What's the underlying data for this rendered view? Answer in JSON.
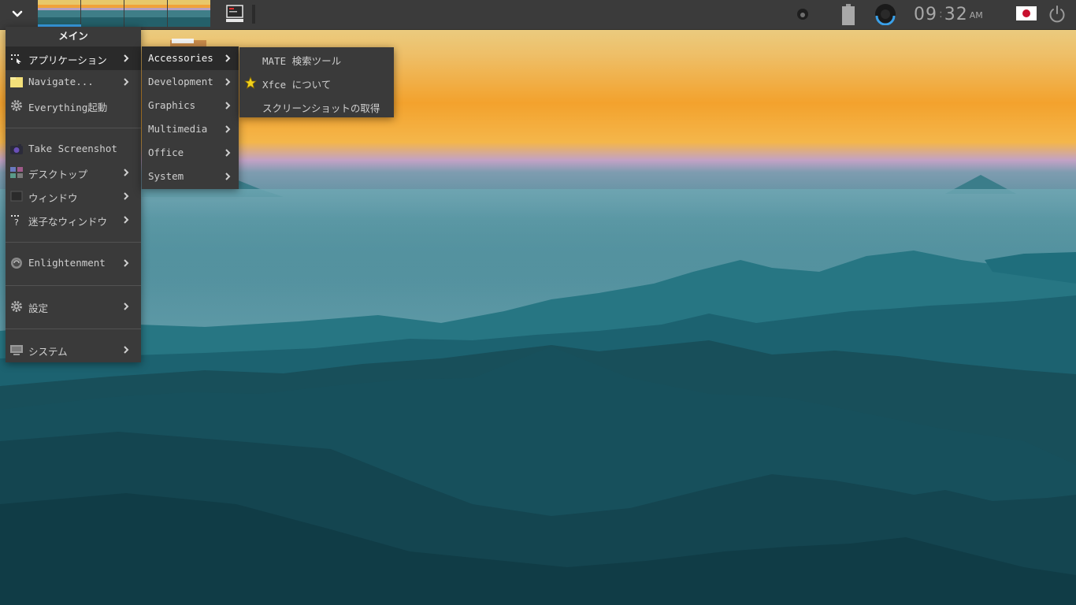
{
  "shelf": {
    "clock": {
      "hours": "09",
      "separator": ":",
      "minutes": "32",
      "ampm": "AM"
    },
    "icons": [
      "start-menu-chevron-icon",
      "pager-desktops",
      "terminal-launcher-icon",
      "volume-icon",
      "battery-icon",
      "disk-usage-icon",
      "japan-flag-icon",
      "power-icon"
    ]
  },
  "main_menu": {
    "title": "メイン",
    "items": [
      {
        "label": "アプリケーション",
        "icon": "applications-icon",
        "submenu": true,
        "selected": true
      },
      {
        "label": "Navigate...",
        "icon": "folder-icon",
        "submenu": true
      },
      {
        "label": "Everything起動",
        "icon": "gear-icon",
        "submenu": false
      },
      {
        "label": "Take Screenshot",
        "icon": "camera-icon",
        "submenu": false
      },
      {
        "label": "デスクトップ",
        "icon": "desktop-icon",
        "submenu": true
      },
      {
        "label": "ウィンドウ",
        "icon": "window-icon",
        "submenu": true
      },
      {
        "label": "迷子なウィンドウ",
        "icon": "lost-window-icon",
        "submenu": true
      },
      {
        "label": "Enlightenment",
        "icon": "enlightenment-icon",
        "submenu": true
      },
      {
        "label": "設定",
        "icon": "settings-gear-icon",
        "submenu": true
      },
      {
        "label": "システム",
        "icon": "computer-icon",
        "submenu": true
      }
    ]
  },
  "apps_menu": {
    "items": [
      {
        "label": "Accessories",
        "selected": true
      },
      {
        "label": "Development"
      },
      {
        "label": "Graphics"
      },
      {
        "label": "Multimedia"
      },
      {
        "label": "Office"
      },
      {
        "label": "System"
      }
    ]
  },
  "accessories_menu": {
    "items": [
      {
        "label": "MATE 検索ツール",
        "icon": ""
      },
      {
        "label": "Xfce について",
        "icon": "star-icon"
      },
      {
        "label": "スクリーンショットの取得",
        "icon": ""
      }
    ]
  },
  "colors": {
    "shelf_bg": "#3b3b3b",
    "menu_bg": "#3a3a3a",
    "menu_selected": "#2a2a2a",
    "pager_active": "#3aa0e8",
    "flag_red": "#c8102e"
  }
}
